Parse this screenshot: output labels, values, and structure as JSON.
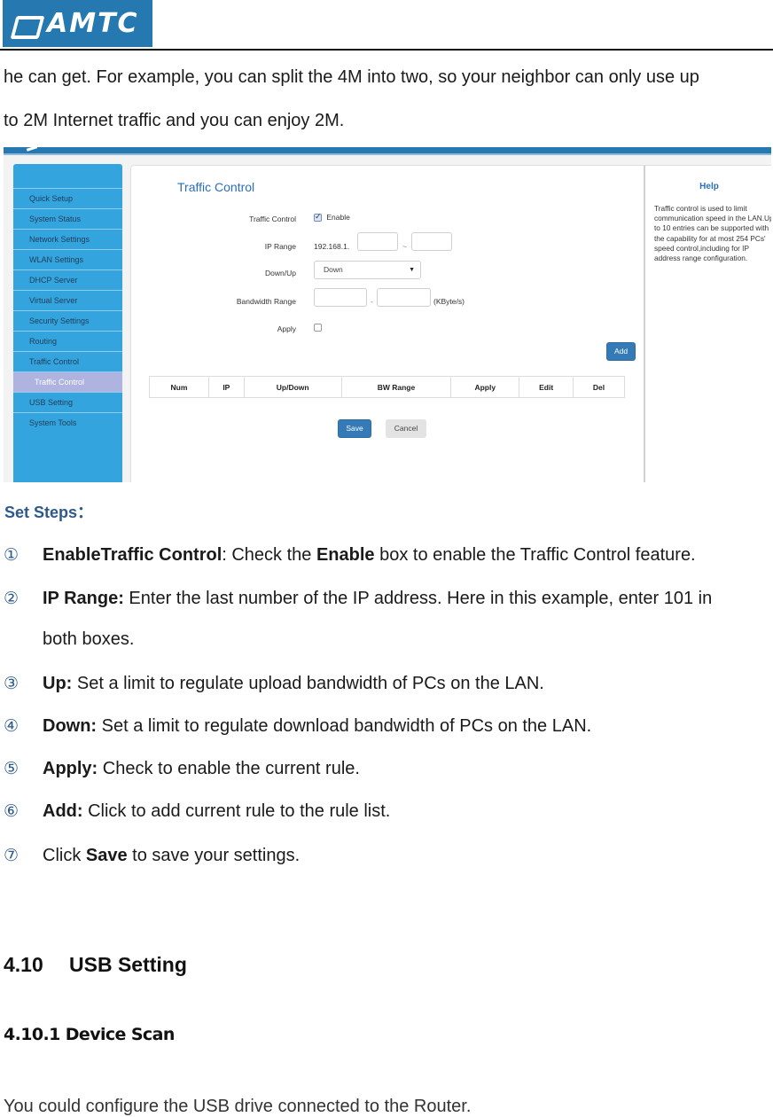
{
  "header": {
    "logo_text": "AMTC"
  },
  "intro": {
    "line1": "he can get. For example, you can split the 4M into two, so your neighbor can only use up",
    "line2": "to 2M Internet traffic and you can enjoy 2M."
  },
  "router_ui": {
    "sidebar": {
      "items": [
        {
          "label": "Quick Setup"
        },
        {
          "label": "System Status"
        },
        {
          "label": "Network Settings"
        },
        {
          "label": "WLAN Settings"
        },
        {
          "label": "DHCP Server"
        },
        {
          "label": "Virtual Server"
        },
        {
          "label": "Security Settings"
        },
        {
          "label": "Routing"
        },
        {
          "label": "Traffic Control"
        },
        {
          "label": "Traffic Control",
          "active": true
        },
        {
          "label": "USB Setting"
        },
        {
          "label": "System Tools"
        }
      ]
    },
    "title": "Traffic Control",
    "form": {
      "traffic_control_label": "Traffic Control",
      "enable_label": "Enable",
      "enable_checked": true,
      "ip_range_label": "IP Range",
      "ip_prefix": "192.168.1.",
      "ip_start_value": "",
      "ip_separator": "~",
      "ip_end_value": "",
      "down_up_label": "Down/Up",
      "down_up_selected": "Down",
      "bandwidth_label": "Bandwidth Range",
      "bw_min_value": "",
      "bw_separator": "-",
      "bw_max_value": "",
      "bw_unit": "(KByte/s)",
      "apply_label": "Apply",
      "apply_checked": false
    },
    "add_button": "Add",
    "table": {
      "columns": [
        "Num",
        "IP",
        "Up/Down",
        "BW Range",
        "Apply",
        "Edit",
        "Del"
      ],
      "rows": []
    },
    "save_button": "Save",
    "cancel_button": "Cancel",
    "help": {
      "title": "Help",
      "text": "Traffic control is used to limit communication speed in the LAN.Up to 10 entries can be supported with the capability for at most 254 PCs' speed control,including for IP address range configuration."
    }
  },
  "steps": {
    "title": "Set Steps：",
    "items": [
      {
        "num": "①",
        "bold": "EnableTraffic Control",
        "text": ": Check the ",
        "bold2": "Enable",
        "text2": " box to enable the Traffic Control feature."
      },
      {
        "num": "②",
        "bold": "IP Range:",
        "text": " Enter the last number of the IP address. Here in this example, enter 101 in",
        "cont": "both boxes."
      },
      {
        "num": "③",
        "bold": "Up:",
        "text": " Set a limit to regulate upload bandwidth of PCs on the LAN."
      },
      {
        "num": "④",
        "bold": "Down:",
        "text": " Set a limit to regulate download bandwidth of PCs on the LAN."
      },
      {
        "num": "⑤",
        "bold": "Apply:",
        "text": " Check to enable the current rule."
      },
      {
        "num": "⑥",
        "bold": "Add:",
        "text": " Click to add current rule to the rule list."
      },
      {
        "num": "⑦",
        "pre": "Click ",
        "bold": "Save",
        "text": " to save your settings."
      }
    ]
  },
  "section": {
    "number": "4.10",
    "title": "USB Setting",
    "subsection": "4.10.1 Device Scan",
    "body": "You could configure the USB drive connected to the Router."
  }
}
